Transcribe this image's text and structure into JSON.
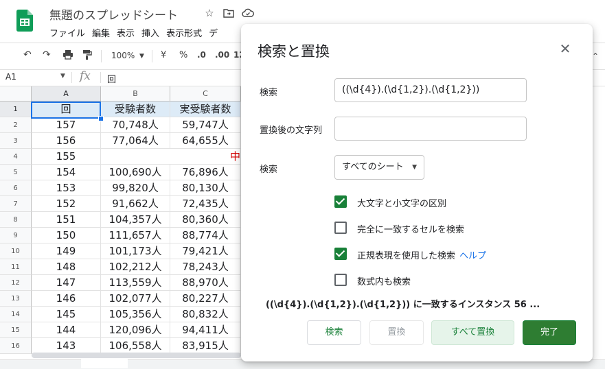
{
  "app": {
    "doc_title": "無題のスプレッドシート",
    "menus": [
      "ファイル",
      "編集",
      "表示",
      "挿入",
      "表示形式",
      "デ"
    ]
  },
  "toolbar": {
    "zoom": "100%",
    "currency": "¥",
    "percent": "%",
    "dec_decrease": ".0",
    "dec_increase": ".00",
    "more_formats": "12"
  },
  "formula_bar": {
    "name_box": "A1",
    "fx": "fx",
    "value": "回"
  },
  "sheet": {
    "columns": [
      "A",
      "B",
      "C"
    ],
    "header_row": [
      "回",
      "受験者数",
      "実受験者数"
    ],
    "rows": [
      {
        "num": "1"
      },
      {
        "num": "2",
        "a": "157",
        "b": "70,748人",
        "c": "59,747人"
      },
      {
        "num": "3",
        "a": "156",
        "b": "77,064人",
        "c": "64,655人"
      },
      {
        "num": "4",
        "a": "155",
        "merged": "中"
      },
      {
        "num": "5",
        "a": "154",
        "b": "100,690人",
        "c": "76,896人"
      },
      {
        "num": "6",
        "a": "153",
        "b": "99,820人",
        "c": "80,130人"
      },
      {
        "num": "7",
        "a": "152",
        "b": "91,662人",
        "c": "72,435人"
      },
      {
        "num": "8",
        "a": "151",
        "b": "104,357人",
        "c": "80,360人"
      },
      {
        "num": "9",
        "a": "150",
        "b": "111,657人",
        "c": "88,774人"
      },
      {
        "num": "10",
        "a": "149",
        "b": "101,173人",
        "c": "79,421人"
      },
      {
        "num": "11",
        "a": "148",
        "b": "102,212人",
        "c": "78,243人"
      },
      {
        "num": "12",
        "a": "147",
        "b": "113,559人",
        "c": "88,970人"
      },
      {
        "num": "13",
        "a": "146",
        "b": "102,077人",
        "c": "80,227人"
      },
      {
        "num": "14",
        "a": "145",
        "b": "105,356人",
        "c": "80,832人"
      },
      {
        "num": "15",
        "a": "144",
        "b": "120,096人",
        "c": "94,411人"
      },
      {
        "num": "16",
        "a": "143",
        "b": "106,558人",
        "c": "83,915人"
      }
    ]
  },
  "dialog": {
    "title": "検索と置換",
    "find_label": "検索",
    "find_value": "((\\d{4}).(\\d{1,2}).(\\d{1,2}))",
    "replace_label": "置換後の文字列",
    "replace_value": "",
    "scope_label": "検索",
    "scope_value": "すべてのシート",
    "options": [
      {
        "label": "大文字と小文字の区別",
        "checked": true
      },
      {
        "label": "完全に一致するセルを検索",
        "checked": false
      },
      {
        "label": "正規表現を使用した検索",
        "checked": true,
        "link": "ヘルプ"
      },
      {
        "label": "数式内も検索",
        "checked": false
      }
    ],
    "result_text": "((\\d{4}).(\\d{1,2}).(\\d{1,2})) に一致するインスタンス 56 ...",
    "buttons": {
      "search": "検索",
      "replace": "置換",
      "replace_all": "すべて置換",
      "done": "完了"
    }
  }
}
